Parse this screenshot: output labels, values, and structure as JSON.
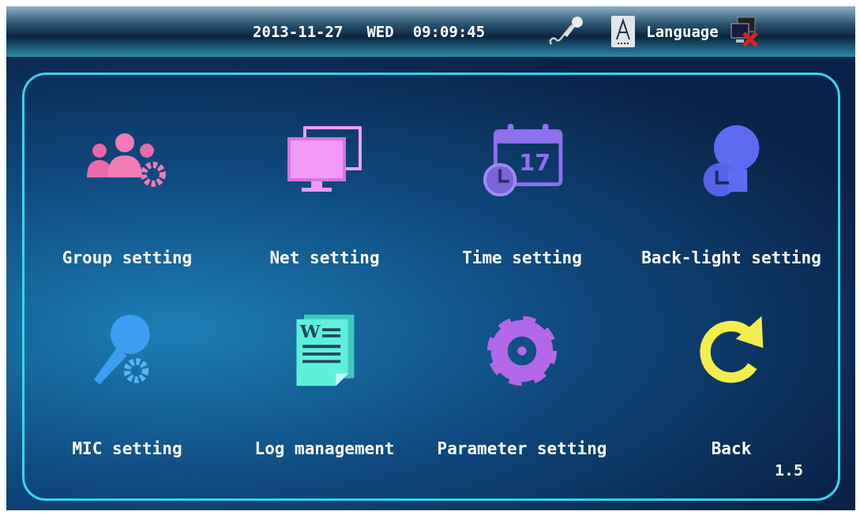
{
  "status_bar": {
    "date": "2013-11-27",
    "weekday": "WED",
    "time": "09:09:45",
    "language_label": "Language"
  },
  "menu": [
    {
      "kind": "group",
      "label": "Group setting"
    },
    {
      "kind": "net",
      "label": "Net setting"
    },
    {
      "kind": "time",
      "label": "Time setting",
      "icon_text": "17"
    },
    {
      "kind": "backlight",
      "label": "Back-light setting"
    },
    {
      "kind": "mic",
      "label": "MIC setting"
    },
    {
      "kind": "log",
      "label": "Log management",
      "icon_text": "W"
    },
    {
      "kind": "parameter",
      "label": "Parameter setting"
    },
    {
      "kind": "back",
      "label": "Back"
    }
  ],
  "version": "1.5"
}
